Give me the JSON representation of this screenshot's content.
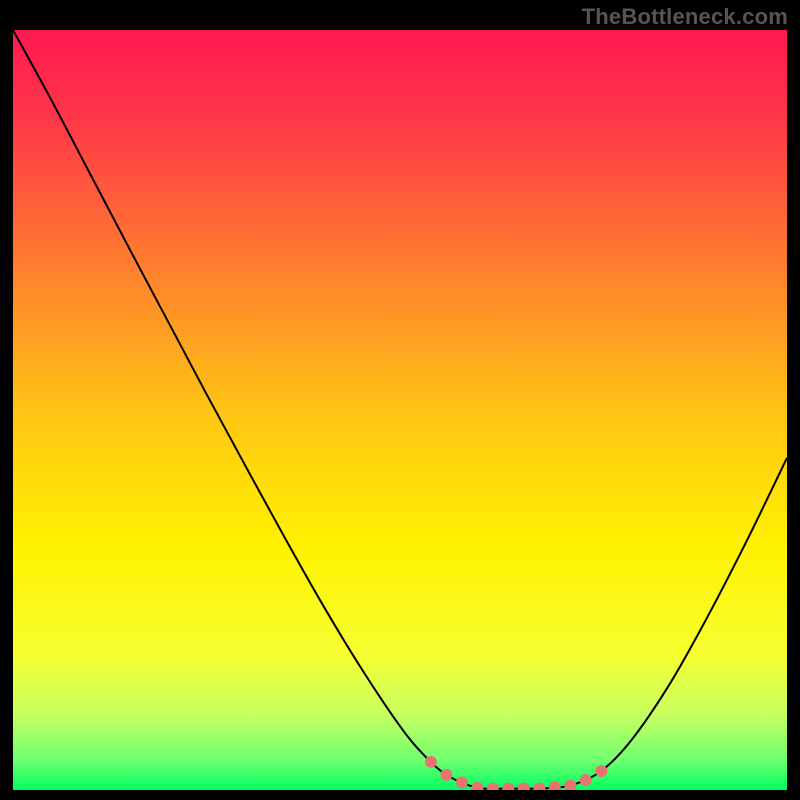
{
  "watermark": "TheBottleneck.com",
  "chart_data": {
    "type": "line",
    "title": "",
    "xlabel": "",
    "ylabel": "",
    "xlim": [
      0,
      1
    ],
    "ylim": [
      0,
      1
    ],
    "grid": false,
    "legend": false,
    "series": [
      {
        "name": "main-curve",
        "color": "#000000",
        "x": [
          0.0,
          0.05,
          0.1,
          0.15,
          0.2,
          0.25,
          0.3,
          0.35,
          0.4,
          0.45,
          0.5,
          0.53,
          0.56,
          0.6,
          0.64,
          0.68,
          0.72,
          0.76,
          0.8,
          0.85,
          0.9,
          0.95,
          1.0
        ],
        "values": [
          1.0,
          0.907,
          0.81,
          0.713,
          0.617,
          0.521,
          0.427,
          0.334,
          0.244,
          0.16,
          0.084,
          0.047,
          0.02,
          0.003,
          0.002,
          0.002,
          0.006,
          0.025,
          0.067,
          0.142,
          0.233,
          0.332,
          0.437
        ]
      },
      {
        "name": "accent-dots",
        "color": "#e77471",
        "x": [
          0.54,
          0.56,
          0.58,
          0.6,
          0.62,
          0.64,
          0.66,
          0.68,
          0.7,
          0.72,
          0.74,
          0.76
        ],
        "values": [
          0.037,
          0.02,
          0.01,
          0.003,
          0.002,
          0.002,
          0.002,
          0.002,
          0.004,
          0.006,
          0.013,
          0.025
        ]
      }
    ],
    "gradient_stops": [
      {
        "offset": 0.0,
        "color": "#ff1850"
      },
      {
        "offset": 0.12,
        "color": "#ff3848"
      },
      {
        "offset": 0.3,
        "color": "#ff7a30"
      },
      {
        "offset": 0.5,
        "color": "#ffc414"
      },
      {
        "offset": 0.68,
        "color": "#fff200"
      },
      {
        "offset": 0.82,
        "color": "#f6ff30"
      },
      {
        "offset": 0.9,
        "color": "#c8ff60"
      },
      {
        "offset": 0.96,
        "color": "#70ff70"
      },
      {
        "offset": 1.0,
        "color": "#00ff62"
      }
    ]
  }
}
